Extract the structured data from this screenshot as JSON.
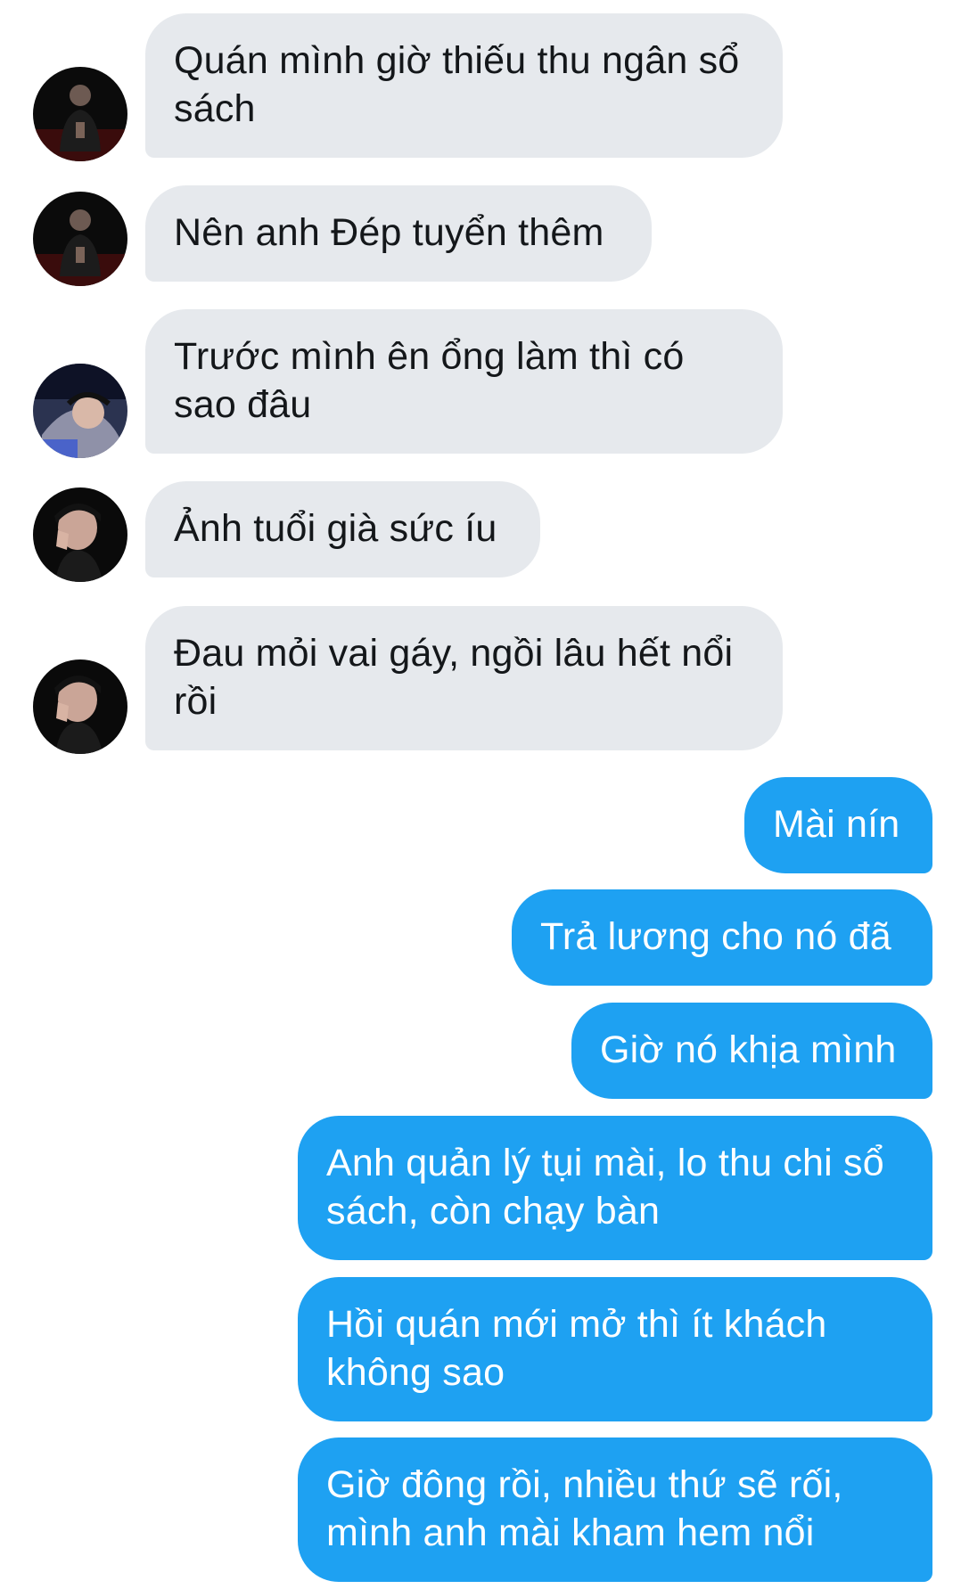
{
  "conversation": {
    "incoming": [
      {
        "text": "Quán mình giờ thiếu thu ngân sổ sách",
        "avatar": "avatar-a"
      },
      {
        "text": "Nên anh Đép tuyển thêm",
        "avatar": "avatar-a"
      },
      {
        "text": "Trước mình ên ổng làm thì có sao đâu",
        "avatar": "avatar-b"
      },
      {
        "text": "Ảnh tuổi già sức íu",
        "avatar": "avatar-c"
      },
      {
        "text": "Đau mỏi vai gáy, ngồi lâu hết nổi rồi",
        "avatar": "avatar-c"
      }
    ],
    "outgoing": [
      {
        "text": "Mài nín"
      },
      {
        "text": "Trả lương cho nó đã"
      },
      {
        "text": "Giờ nó khịa mình"
      },
      {
        "text": "Anh quản lý tụi mài, lo thu chi sổ sách, còn chạy bàn"
      },
      {
        "text": "Hồi quán mới mở thì ít khách không sao"
      },
      {
        "text": "Giờ đông rồi, nhiều thứ sẽ rối, mình anh mài kham hem nổi"
      }
    ]
  },
  "colors": {
    "incoming_bubble": "#e6e9ed",
    "outgoing_bubble": "#1ea1f2",
    "incoming_text": "#14171a",
    "outgoing_text": "#ffffff"
  }
}
